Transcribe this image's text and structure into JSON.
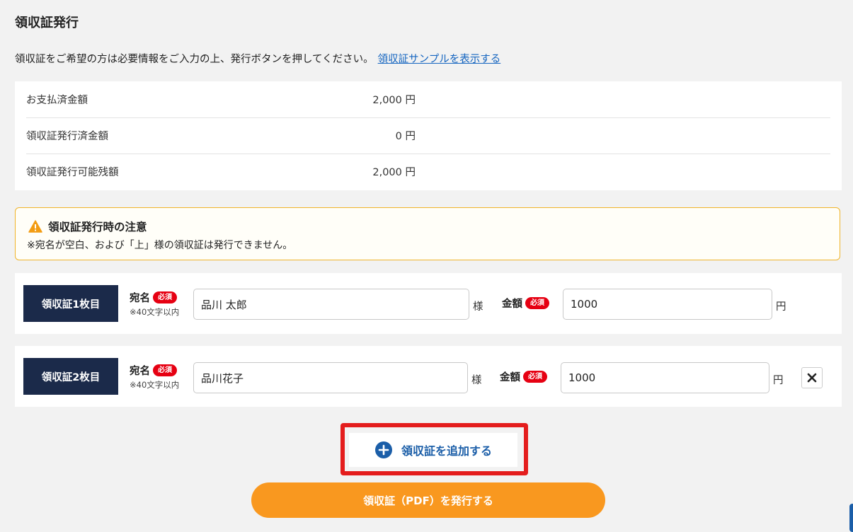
{
  "page": {
    "title": "領収証発行",
    "intro_text": "領収証をご希望の方は必要情報をご入力の上、発行ボタンを押してください。",
    "sample_link": "領収証サンプルを表示する"
  },
  "summary": [
    {
      "label": "お支払済金額",
      "value": "2,000 円"
    },
    {
      "label": "領収証発行済金額",
      "value": "0 円"
    },
    {
      "label": "領収証発行可能残額",
      "value": "2,000 円"
    }
  ],
  "notice": {
    "title": "領収証発行時の注意",
    "body": "※宛名が空白、および「上」様の領収証は発行できません。"
  },
  "receipts": [
    {
      "tag": "領収証1枚目",
      "name_label": "宛名",
      "required": "必須",
      "hint": "※40文字以内",
      "name_value": "品川 太郎",
      "honorific": "様",
      "amount_label": "金額",
      "amount_value": "1000",
      "unit": "円"
    },
    {
      "tag": "領収証2枚目",
      "name_label": "宛名",
      "required": "必須",
      "hint": "※40文字以内",
      "name_value": "品川花子",
      "honorific": "様",
      "amount_label": "金額",
      "amount_value": "1000",
      "unit": "円"
    }
  ],
  "actions": {
    "add_label": "領収証を追加する",
    "issue_label": "領収証（PDF）を発行する"
  },
  "colors": {
    "accent_blue": "#1b5ea8",
    "navy": "#1b2a4a",
    "required_red": "#e60012",
    "orange": "#f9981f",
    "warning": "#f0b429",
    "highlight": "#e41d1d"
  }
}
